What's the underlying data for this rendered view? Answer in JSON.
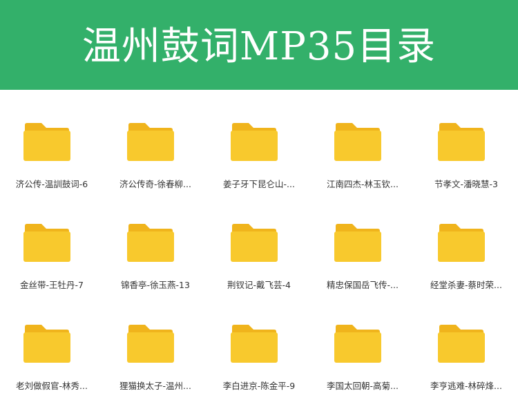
{
  "header": {
    "title": "温州鼓词MP35目录"
  },
  "colors": {
    "header_bg": "#33b06a",
    "folder_back": "#f0b41c",
    "folder_front": "#f8c92d"
  },
  "folders": [
    {
      "label": "济公传-温訓鼓词-6",
      "icon": "folder-icon"
    },
    {
      "label": "济公传奇-徐春柳...",
      "icon": "folder-icon"
    },
    {
      "label": "姜子牙下昆仑山-...",
      "icon": "folder-icon"
    },
    {
      "label": "江南四杰-林玉钦...",
      "icon": "folder-icon"
    },
    {
      "label": "节孝文-潘晓慧-3",
      "icon": "folder-icon"
    },
    {
      "label": "金丝带-王牡丹-7",
      "icon": "folder-icon"
    },
    {
      "label": "锦香亭-徐玉燕-13",
      "icon": "folder-icon"
    },
    {
      "label": "荆钗记-戴飞芸-4",
      "icon": "folder-icon"
    },
    {
      "label": "精忠保国岳飞传-...",
      "icon": "folder-icon"
    },
    {
      "label": "经堂杀妻-蔡时荣...",
      "icon": "folder-icon"
    },
    {
      "label": "老刘做假官-林秀...",
      "icon": "folder-icon"
    },
    {
      "label": "狸猫换太子-温州...",
      "icon": "folder-icon"
    },
    {
      "label": "李白进京-陈金平-9",
      "icon": "folder-icon"
    },
    {
      "label": "李国太回朝-高菊...",
      "icon": "folder-icon"
    },
    {
      "label": "李亨逃难-林碎烽...",
      "icon": "folder-icon"
    }
  ]
}
